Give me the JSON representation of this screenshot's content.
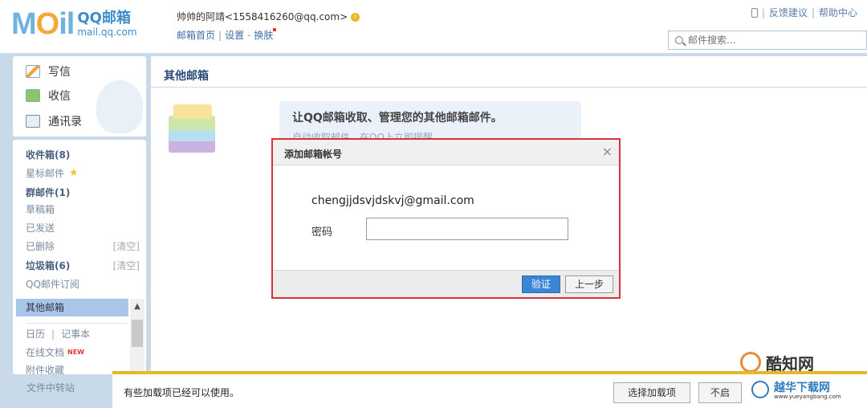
{
  "header": {
    "logo_big": "MOil",
    "logo_o": "O",
    "logo_qq": "QQ邮箱",
    "logo_url": "mail.qq.com",
    "user_name": "帅帅的阿靖<1558416260@qq.com>",
    "links": [
      "邮箱首页",
      "设置",
      "换肤"
    ],
    "sep_pipe": "|",
    "sep_dash": "-",
    "top_right": [
      "反馈建议",
      "帮助中心"
    ],
    "search_placeholder": "邮件搜索..."
  },
  "sidebar": {
    "actions": [
      "写信",
      "收信",
      "通讯录"
    ],
    "folders": [
      {
        "label": "收件箱(8)",
        "bold": true
      },
      {
        "label": "星标邮件",
        "bold": false
      },
      {
        "label": "群邮件(1)",
        "bold": true
      },
      {
        "label": "草稿箱",
        "bold": false
      },
      {
        "label": "已发送",
        "bold": false
      },
      {
        "label": "已删除",
        "bold": false
      },
      {
        "label": "垃圾箱(6)",
        "bold": true
      },
      {
        "label": "QQ邮件订阅",
        "bold": false
      }
    ],
    "clear_label": "[清空]",
    "selected": "其他邮箱",
    "tools": {
      "calendar": "日历",
      "notes": "记事本",
      "docs": "在线文档",
      "attachments": "附件收藏",
      "transfer": "文件中转站"
    },
    "new_badge": "NEW",
    "scroll_up": "▲"
  },
  "main": {
    "title": "其他邮箱",
    "promo_title": "让QQ邮箱收取、管理您的其他邮箱邮件。",
    "promo_sub": "自动收取邮件，在QQ上立即提醒。"
  },
  "dialog": {
    "title": "添加邮箱帐号",
    "close": "×",
    "email": "chengjjdsvjdskvj@gmail.com",
    "password_label": "密码",
    "verify": "验证",
    "prev": "上一步"
  },
  "notification": {
    "text": "有些加载项已经可以使用。",
    "btn_select": "选择加载项",
    "btn_disable": "不启"
  },
  "watermarks": {
    "kuzhi": "酷知网",
    "site": "越华下载网",
    "site_url": "www.yueyangbang.com"
  }
}
